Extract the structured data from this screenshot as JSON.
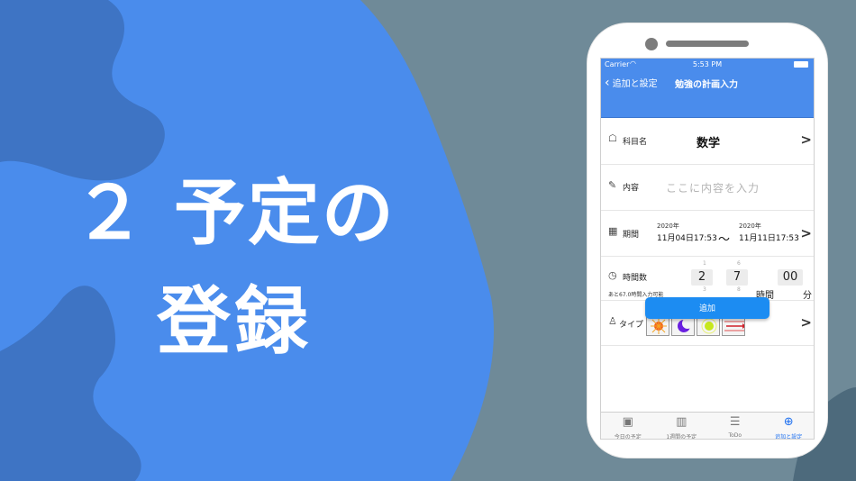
{
  "headline": {
    "line1": "２ 予定の",
    "line2": "登録"
  },
  "status_bar": {
    "carrier": "Carrier",
    "time": "5:53 PM"
  },
  "nav": {
    "back_label": "追加と設定",
    "title": "勉強の計画入力"
  },
  "subject": {
    "label": "科目名",
    "value": "数学",
    "arrow": ">"
  },
  "content": {
    "label": "内容",
    "placeholder": "ここに内容を入力"
  },
  "period": {
    "label": "期間",
    "start_year": "2020年",
    "start_date": "11月04日17:53",
    "separator": "〜",
    "end_year": "2020年",
    "end_date": "11月11日17:53",
    "arrow": ">"
  },
  "hours": {
    "label": "時間数",
    "note": "あと67.0時間入力可能",
    "hour_value": "2",
    "hour_value2": "7",
    "hour_unit": "時間",
    "minute_value": "00",
    "minute_unit": "分"
  },
  "type": {
    "label": "タイプ",
    "arrow": ">"
  },
  "add_button": {
    "label": "追加"
  },
  "tabs": [
    {
      "label": "今日の予定",
      "icon": "square-icon"
    },
    {
      "label": "1週間の予定",
      "icon": "calendar-grid-icon"
    },
    {
      "label": "ToDo",
      "icon": "checklist-icon"
    },
    {
      "label": "追加と設定",
      "icon": "plus-circle-icon"
    }
  ],
  "colors": {
    "bar_blue": "#4a8cec",
    "bg_blue": "#4a8cec",
    "bg_slate": "#6f8a98",
    "button_blue": "#1c8cf2"
  }
}
